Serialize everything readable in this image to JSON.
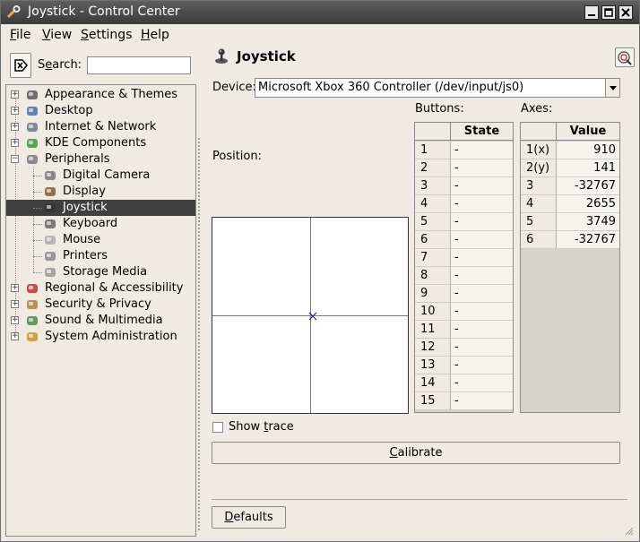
{
  "window": {
    "title": "Joystick - Control Center"
  },
  "menu": [
    {
      "label": "File",
      "mnemonic": "F",
      "rest": "ile"
    },
    {
      "label": "View",
      "mnemonic": "V",
      "rest": "iew"
    },
    {
      "label": "Settings",
      "mnemonic": "S",
      "rest": "ettings"
    },
    {
      "label": "Help",
      "mnemonic": "H",
      "rest": "elp"
    }
  ],
  "search": {
    "label_pre": "S",
    "label_mn": "e",
    "label_post": "arch:",
    "value": ""
  },
  "tree": [
    {
      "label": "Appearance & Themes",
      "expander": "+",
      "icon": "appearance-icon"
    },
    {
      "label": "Desktop",
      "expander": "+",
      "icon": "desktop-icon"
    },
    {
      "label": "Internet & Network",
      "expander": "+",
      "icon": "network-icon"
    },
    {
      "label": "KDE Components",
      "expander": "+",
      "icon": "kde-components-icon"
    },
    {
      "label": "Peripherals",
      "expander": "−",
      "icon": "peripherals-icon"
    },
    {
      "label": "Digital Camera",
      "icon": "camera-icon"
    },
    {
      "label": "Display",
      "icon": "display-icon"
    },
    {
      "label": "Joystick",
      "icon": "joystick-icon",
      "selected": true
    },
    {
      "label": "Keyboard",
      "icon": "keyboard-icon"
    },
    {
      "label": "Mouse",
      "icon": "mouse-icon"
    },
    {
      "label": "Printers",
      "icon": "printer-icon"
    },
    {
      "label": "Storage Media",
      "icon": "storage-icon"
    },
    {
      "label": "Regional & Accessibility",
      "expander": "+",
      "icon": "regional-icon"
    },
    {
      "label": "Security & Privacy",
      "expander": "+",
      "icon": "security-icon"
    },
    {
      "label": "Sound & Multimedia",
      "expander": "+",
      "icon": "sound-icon"
    },
    {
      "label": "System Administration",
      "expander": "+",
      "icon": "system-admin-icon"
    }
  ],
  "content": {
    "title": "Joystick",
    "device_label": "Device:",
    "device_value": "Microsoft Xbox 360 Controller (/dev/input/js0)",
    "position_label": "Position:",
    "buttons_label": "Buttons:",
    "axes_label": "Axes:",
    "buttons_header": "State",
    "buttons": [
      {
        "id": "1",
        "state": "-"
      },
      {
        "id": "2",
        "state": "-"
      },
      {
        "id": "3",
        "state": "-"
      },
      {
        "id": "4",
        "state": "-"
      },
      {
        "id": "5",
        "state": "-"
      },
      {
        "id": "6",
        "state": "-"
      },
      {
        "id": "7",
        "state": "-"
      },
      {
        "id": "8",
        "state": "-"
      },
      {
        "id": "9",
        "state": "-"
      },
      {
        "id": "10",
        "state": "-"
      },
      {
        "id": "11",
        "state": "-"
      },
      {
        "id": "12",
        "state": "-"
      },
      {
        "id": "13",
        "state": "-"
      },
      {
        "id": "14",
        "state": "-"
      },
      {
        "id": "15",
        "state": "-"
      }
    ],
    "axes_header": "Value",
    "axes": [
      {
        "id": "1(x)",
        "value": "910"
      },
      {
        "id": "2(y)",
        "value": "141"
      },
      {
        "id": "3",
        "value": "-32767"
      },
      {
        "id": "4",
        "value": "2655"
      },
      {
        "id": "5",
        "value": "3749"
      },
      {
        "id": "6",
        "value": "-32767"
      }
    ],
    "show_trace": {
      "pre": "Show ",
      "mn": "t",
      "post": "race",
      "checked": false
    },
    "calibrate": {
      "mn": "C",
      "post": "alibrate"
    },
    "defaults": {
      "mn": "D",
      "post": "efaults"
    }
  }
}
